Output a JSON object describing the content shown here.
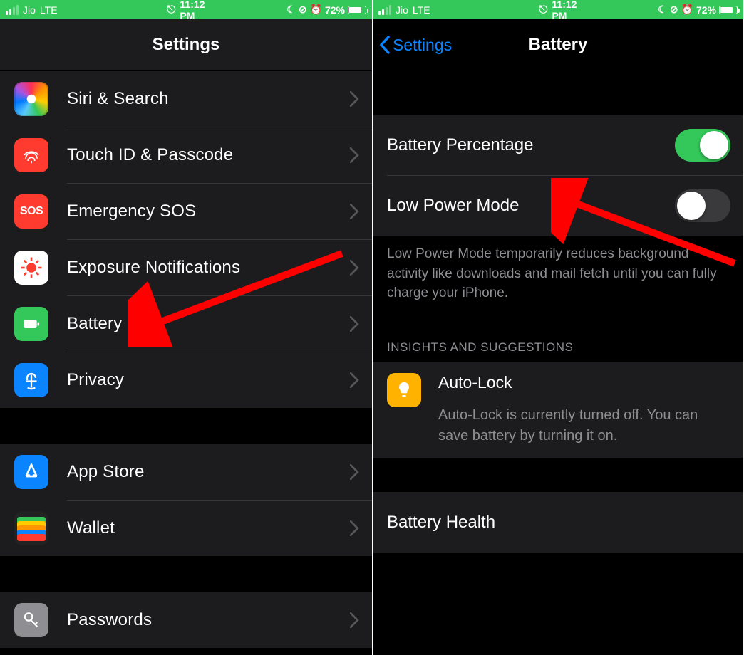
{
  "status": {
    "carrier": "Jio",
    "network": "LTE",
    "time": "11:12 PM",
    "battery_pct": "72%"
  },
  "left": {
    "title": "Settings",
    "items": {
      "siri": "Siri & Search",
      "touch": "Touch ID & Passcode",
      "sos": "Emergency SOS",
      "expo": "Exposure Notifications",
      "batt": "Battery",
      "priv": "Privacy",
      "store": "App Store",
      "wallet": "Wallet",
      "pw": "Passwords"
    },
    "sos_text": "SOS"
  },
  "right": {
    "back": "Settings",
    "title": "Battery",
    "battery_percentage_label": "Battery Percentage",
    "low_power_label": "Low Power Mode",
    "low_power_footer": "Low Power Mode temporarily reduces background activity like downloads and mail fetch until you can fully charge your iPhone.",
    "section_header": "INSIGHTS AND SUGGESTIONS",
    "autolock": {
      "title": "Auto-Lock",
      "detail": "Auto-Lock is currently turned off. You can save battery by turning it on."
    },
    "battery_health": "Battery Health"
  }
}
